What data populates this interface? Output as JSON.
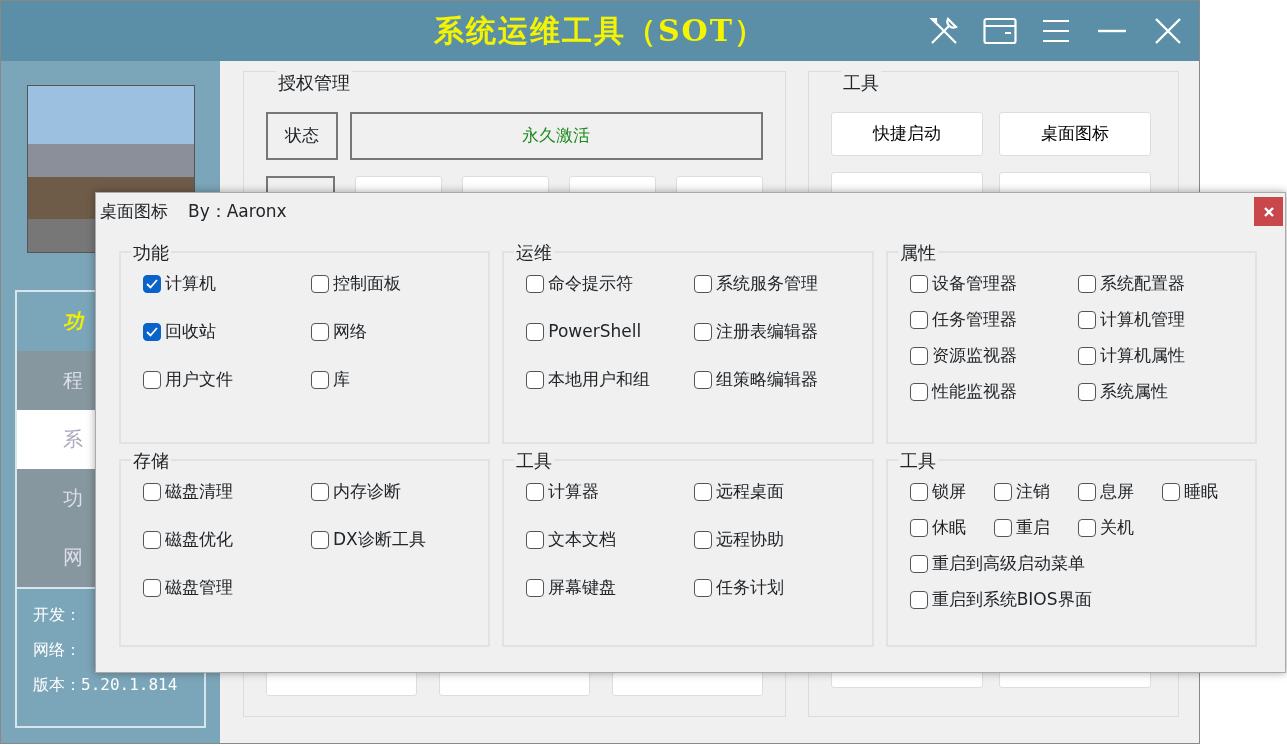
{
  "window": {
    "title": "系统运维工具（SOT）"
  },
  "sidebar": {
    "items": [
      {
        "label": "功",
        "selected": false,
        "kind": "header"
      },
      {
        "label": "程",
        "selected": false,
        "kind": "item"
      },
      {
        "label": "系",
        "selected": true,
        "kind": "item"
      },
      {
        "label": "功",
        "selected": false,
        "kind": "item"
      },
      {
        "label": "网",
        "selected": false,
        "kind": "item"
      }
    ],
    "info": [
      "开发：",
      "网络：",
      "版本：5.20.1.814"
    ]
  },
  "auth_panel": {
    "title": "授权管理",
    "status_label": "状态",
    "status_value": "永久激活"
  },
  "tools_panel": {
    "title": "工具",
    "buttons": [
      "快捷启动",
      "桌面图标"
    ]
  },
  "dialog": {
    "title": "桌面图标",
    "author": "By：Aaronx",
    "groups": [
      {
        "title": "功能",
        "items": [
          {
            "label": "计算机",
            "checked": true
          },
          {
            "label": "控制面板",
            "checked": false
          },
          {
            "label": "回收站",
            "checked": true
          },
          {
            "label": "网络",
            "checked": false
          },
          {
            "label": "用户文件",
            "checked": false
          },
          {
            "label": "库",
            "checked": false
          }
        ]
      },
      {
        "title": "存储",
        "items": [
          {
            "label": "磁盘清理",
            "checked": false
          },
          {
            "label": "内存诊断",
            "checked": false
          },
          {
            "label": "磁盘优化",
            "checked": false
          },
          {
            "label": "DX诊断工具",
            "checked": false
          },
          {
            "label": "磁盘管理",
            "checked": false
          }
        ]
      },
      {
        "title": "运维",
        "items": [
          {
            "label": "命令提示符",
            "checked": false
          },
          {
            "label": "系统服务管理",
            "checked": false
          },
          {
            "label": "PowerShell",
            "checked": false
          },
          {
            "label": "注册表编辑器",
            "checked": false
          },
          {
            "label": "本地用户和组",
            "checked": false
          },
          {
            "label": "组策略编辑器",
            "checked": false
          }
        ]
      },
      {
        "title": "工具",
        "items": [
          {
            "label": "计算器",
            "checked": false
          },
          {
            "label": "远程桌面",
            "checked": false
          },
          {
            "label": "文本文档",
            "checked": false
          },
          {
            "label": "远程协助",
            "checked": false
          },
          {
            "label": "屏幕键盘",
            "checked": false
          },
          {
            "label": "任务计划",
            "checked": false
          }
        ]
      },
      {
        "title": "属性",
        "items": [
          {
            "label": "设备管理器",
            "checked": false
          },
          {
            "label": "系统配置器",
            "checked": false
          },
          {
            "label": "任务管理器",
            "checked": false
          },
          {
            "label": "计算机管理",
            "checked": false
          },
          {
            "label": "资源监视器",
            "checked": false
          },
          {
            "label": "计算机属性",
            "checked": false
          },
          {
            "label": "性能监视器",
            "checked": false
          },
          {
            "label": "系统属性",
            "checked": false
          }
        ]
      },
      {
        "title": "工具",
        "items": [
          {
            "label": "锁屏",
            "checked": false
          },
          {
            "label": "注销",
            "checked": false
          },
          {
            "label": "息屏",
            "checked": false
          },
          {
            "label": "睡眠",
            "checked": false
          },
          {
            "label": "休眠",
            "checked": false
          },
          {
            "label": "重启",
            "checked": false
          },
          {
            "label": "关机",
            "checked": false
          },
          {
            "label": "重启到高级启动菜单",
            "checked": false,
            "kind": "wide"
          },
          {
            "label": "重启到系统BIOS界面",
            "checked": false,
            "kind": "wide"
          }
        ]
      }
    ]
  }
}
